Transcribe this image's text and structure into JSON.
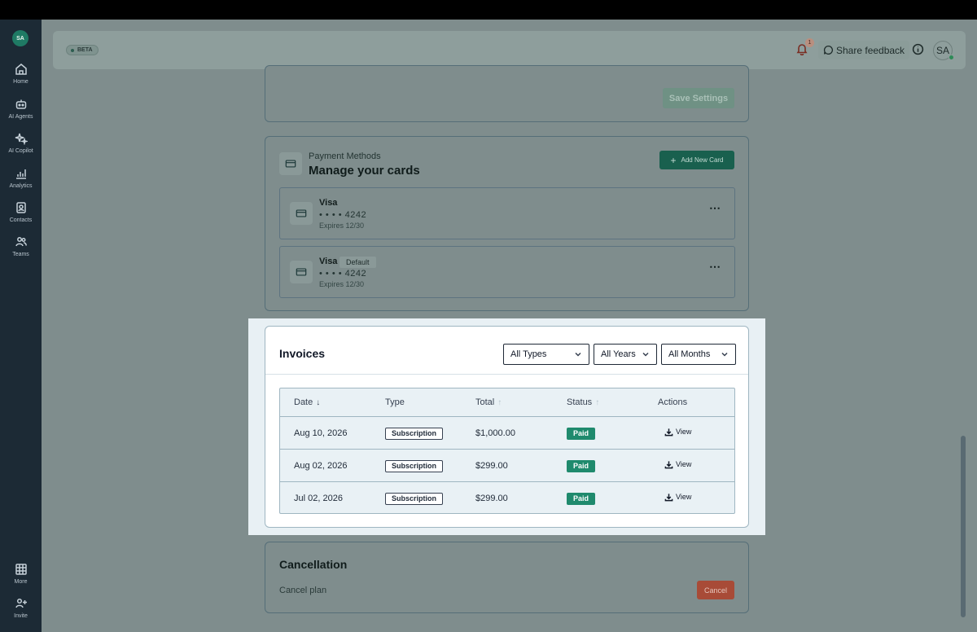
{
  "sidebar": {
    "avatar_initials": "SA",
    "items": [
      {
        "label": "Home",
        "icon": "home-icon"
      },
      {
        "label": "AI Agents",
        "icon": "robot-icon"
      },
      {
        "label": "AI Copilot",
        "icon": "sparkles-icon"
      },
      {
        "label": "Analytics",
        "icon": "chart-icon"
      },
      {
        "label": "Contacts",
        "icon": "contacts-icon"
      },
      {
        "label": "Teams",
        "icon": "users-icon"
      }
    ],
    "bottom_items": [
      {
        "label": "More",
        "icon": "grid-icon"
      },
      {
        "label": "Invite",
        "icon": "user-plus-icon"
      }
    ]
  },
  "header": {
    "beta_label": "BETA",
    "notification_count": "1",
    "feedback_label": "Share feedback",
    "avatar_initials": "SA"
  },
  "settings_card": {
    "save_label": "Save Settings"
  },
  "payment_methods": {
    "subtitle": "Payment Methods",
    "title": "Manage your cards",
    "add_label": "Add New Card",
    "cards": [
      {
        "brand": "Visa",
        "masked": "• • • •   4242",
        "expires": "Expires 12/30",
        "badge": ""
      },
      {
        "brand": "Visa",
        "masked": "• • • •   4242",
        "expires": "Expires 12/30",
        "badge": "Default"
      }
    ]
  },
  "invoices": {
    "title": "Invoices",
    "filters": {
      "type": "All Types",
      "year": "All Years",
      "month": "All Months"
    },
    "columns": {
      "date": "Date",
      "type": "Type",
      "total": "Total",
      "status": "Status",
      "actions": "Actions"
    },
    "rows": [
      {
        "date": "Aug 10, 2026",
        "type": "Subscription",
        "total": "$1,000.00",
        "status": "Paid",
        "action": "View"
      },
      {
        "date": "Aug 02, 2026",
        "type": "Subscription",
        "total": "$299.00",
        "status": "Paid",
        "action": "View"
      },
      {
        "date": "Jul 02, 2026",
        "type": "Subscription",
        "total": "$299.00",
        "status": "Paid",
        "action": "View"
      }
    ]
  },
  "cancellation": {
    "title": "Cancellation",
    "text": "Cancel plan",
    "button_label": "Cancel"
  },
  "colors": {
    "accent": "#19604e",
    "paid": "#1f8a6d",
    "danger": "#a84b37",
    "sidebar": "#1c2a35"
  }
}
